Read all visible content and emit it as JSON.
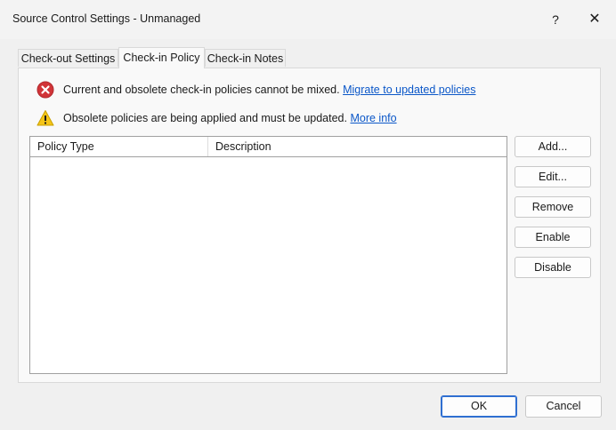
{
  "window": {
    "title": "Source Control Settings - Unmanaged",
    "help_label": "?",
    "close_label": "✕"
  },
  "tabs": [
    {
      "label": "Check-out Settings",
      "active": false
    },
    {
      "label": "Check-in Policy",
      "active": true
    },
    {
      "label": "Check-in Notes",
      "active": false
    }
  ],
  "messages": {
    "error": {
      "icon": "error-icon",
      "text": "Current and obsolete check-in policies cannot be mixed.",
      "link": "Migrate to updated policies"
    },
    "warning": {
      "icon": "warning-icon",
      "text": "Obsolete policies are being applied and must be updated.",
      "link": "More info"
    }
  },
  "policy_list": {
    "columns": [
      "Policy Type",
      "Description"
    ],
    "rows": []
  },
  "side_buttons": {
    "add": "Add...",
    "edit": "Edit...",
    "remove": "Remove",
    "enable": "Enable",
    "disable": "Disable"
  },
  "footer": {
    "ok": "OK",
    "cancel": "Cancel"
  },
  "colors": {
    "link": "#0b57c8",
    "error": "#d13438",
    "warning": "#f5c518",
    "default_button_border": "#2f6fd1"
  }
}
